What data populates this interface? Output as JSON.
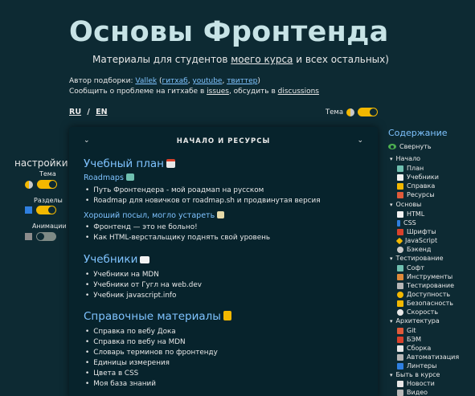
{
  "header": {
    "title": "Основы Фронтенда",
    "subtitle_pre": "Материалы для студентов ",
    "subtitle_link": "моего курса",
    "subtitle_post": " и всех остальных)"
  },
  "meta": {
    "author_label": "Автор подборки: ",
    "author_name": "Vallek",
    "paren_open": " (",
    "link_github": "гитхаб",
    "sep1": ", ",
    "link_youtube": "youtube",
    "sep2": ", ",
    "link_twitter": "твиттер",
    "paren_close": ")",
    "report_pre": "Сообщить о проблеме на гитхабе в ",
    "link_issues": "issues",
    "report_mid": ", обсудить в ",
    "link_discussions": "discussions"
  },
  "lang": {
    "ru": "RU",
    "sep": "/",
    "en": "EN"
  },
  "theme_top": {
    "label": "Тема"
  },
  "settings": {
    "title": "настройки",
    "theme_label": "Тема",
    "sections_label": "Разделы",
    "animations_label": "Анимации",
    "theme_on": true,
    "sections_on": true,
    "animations_on": false
  },
  "card": {
    "heading": "НАЧАЛО И РЕСУРСЫ",
    "plan_title": "Учебный план",
    "roadmaps_title": "Roadmaps",
    "roadmaps_items": [
      "Путь Фронтендера - мой роадмап на русском",
      "Roadmap для новичков от roadmap.sh и продвинутая версия"
    ],
    "posts_title": "Хороший посыл, могло устареть",
    "posts_items": [
      "Фронтенд — это не больно!",
      "Как HTML-верстальщику поднять свой уровень"
    ],
    "textbooks_title": "Учебники",
    "textbooks_items": [
      "Учебники на MDN",
      "Учебники от Гугл на web.dev",
      "Учебник javascript.info"
    ],
    "refs_title": "Справочные материалы",
    "refs_items": [
      "Справка по вебу Дока",
      "Справка по вебу на MDN",
      "Словарь терминов по фронтенду",
      "Единицы измерения",
      "Цвета в CSS",
      "Моя база знаний"
    ]
  },
  "toc": {
    "title": "Содержание",
    "collapse": "Свернуть",
    "sections": [
      {
        "label": "Начало",
        "items": [
          "План",
          "Учебники",
          "Справка",
          "Ресурсы"
        ]
      },
      {
        "label": "Основы",
        "items": [
          "HTML",
          "CSS",
          "Шрифты",
          "JavaScript",
          "Бэкенд"
        ]
      },
      {
        "label": "Тестирование",
        "items": [
          "Софт",
          "Инструменты",
          "Тестирование",
          "Доступность",
          "Безопасность",
          "Скорость"
        ]
      },
      {
        "label": "Архитектура",
        "items": [
          "Git",
          "БЭМ",
          "Сборка",
          "Автоматизация",
          "Линтеры"
        ]
      },
      {
        "label": "Быть в курсе",
        "items": [
          "Новости",
          "Видео"
        ]
      }
    ]
  },
  "colors": {
    "background": "#0d2a33",
    "card": "#07232c",
    "accent_link": "#7fc3ff",
    "title": "#c7e3e6",
    "toggle_on": "#f3b800",
    "toggle_off": "#7e8a86"
  }
}
